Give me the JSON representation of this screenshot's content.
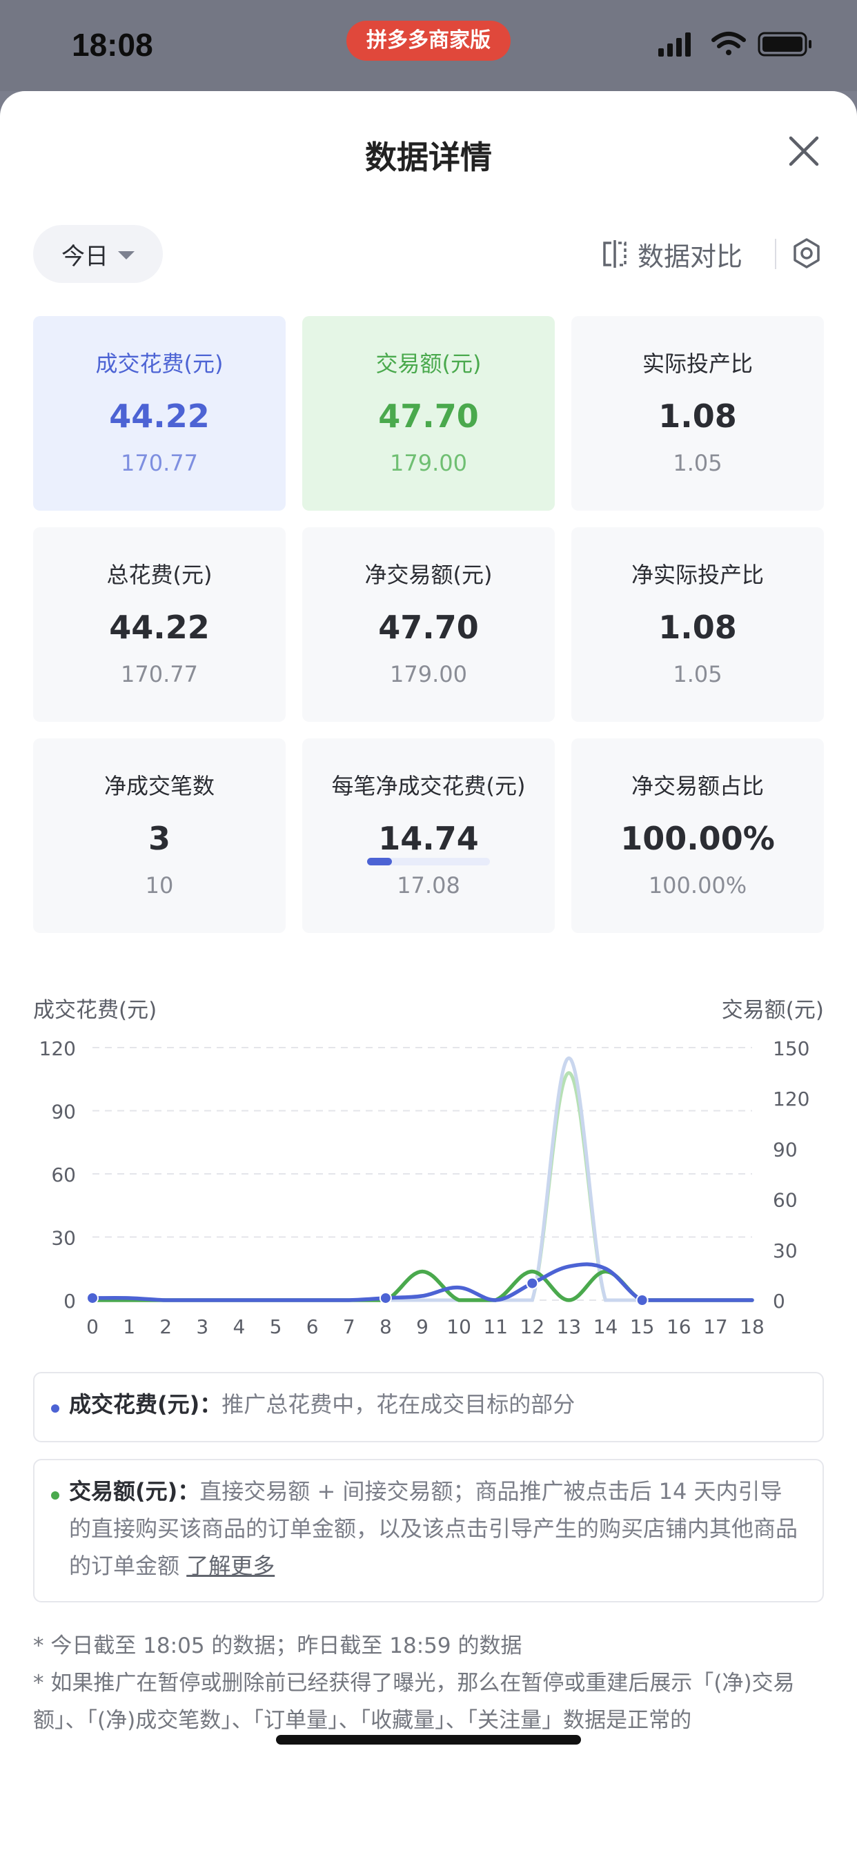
{
  "status_bar": {
    "time": "18:08",
    "app_badge": "拼多多商家版"
  },
  "header": {
    "title": "数据详情"
  },
  "filters": {
    "date_range": "今日",
    "compare_label": "数据对比"
  },
  "metrics": [
    {
      "label": "成交花费(元)",
      "value": "44.22",
      "previous": "170.77",
      "highlight": "blue"
    },
    {
      "label": "交易额(元)",
      "value": "47.70",
      "previous": "179.00",
      "highlight": "green"
    },
    {
      "label": "实际投产比",
      "value": "1.08",
      "previous": "1.05",
      "highlight": ""
    },
    {
      "label": "总花费(元)",
      "value": "44.22",
      "previous": "170.77",
      "highlight": ""
    },
    {
      "label": "净交易额(元)",
      "value": "47.70",
      "previous": "179.00",
      "highlight": ""
    },
    {
      "label": "净实际投产比",
      "value": "1.08",
      "previous": "1.05",
      "highlight": ""
    },
    {
      "label": "净成交笔数",
      "value": "3",
      "previous": "10",
      "highlight": ""
    },
    {
      "label": "每笔净成交花费(元)",
      "value": "14.74",
      "previous": "17.08",
      "highlight": ""
    },
    {
      "label": "净交易额占比",
      "value": "100.00%",
      "previous": "100.00%",
      "highlight": ""
    }
  ],
  "colors": {
    "blue": "#4c63d4",
    "green": "#4aa94d",
    "blue_light": "#c9d6ee",
    "green_light": "#b6e0b4"
  },
  "chart_data": {
    "type": "line",
    "ylabel_left": "成交花费(元)",
    "ylabel_right": "交易额(元)",
    "x": [
      0,
      1,
      2,
      3,
      4,
      5,
      6,
      7,
      8,
      9,
      10,
      11,
      12,
      13,
      14,
      15,
      16,
      17,
      18
    ],
    "left_ticks": [
      "0",
      "30",
      "60",
      "90",
      "120"
    ],
    "right_ticks": [
      "0",
      "30",
      "60",
      "90",
      "120",
      "150"
    ],
    "ylim_left": [
      0,
      120
    ],
    "ylim_right": [
      0,
      150
    ],
    "grid": true,
    "series": [
      {
        "name": "成交花费(元)",
        "axis": "left",
        "period": "today",
        "values": [
          1,
          1,
          0,
          0,
          0,
          0,
          0,
          0,
          1,
          2,
          6,
          0,
          8,
          16,
          15,
          0,
          0,
          0,
          0
        ]
      },
      {
        "name": "交易额(元)",
        "axis": "right",
        "period": "today",
        "values": [
          0,
          0,
          0,
          0,
          0,
          0,
          0,
          0,
          0,
          17,
          0,
          0,
          17,
          0,
          17,
          0,
          0,
          0,
          0
        ]
      },
      {
        "axis": "left",
        "period": "yesterday",
        "values": [
          0,
          0,
          0,
          0,
          0,
          0,
          0,
          0,
          0,
          0,
          0,
          0,
          0,
          115,
          0,
          0,
          0,
          0,
          0
        ]
      },
      {
        "axis": "right",
        "period": "yesterday",
        "values": [
          0,
          0,
          0,
          0,
          0,
          0,
          0,
          0,
          0,
          0,
          0,
          0,
          0,
          135,
          0,
          0,
          0,
          0,
          0
        ]
      }
    ]
  },
  "legend": {
    "spend": {
      "term": "成交花费(元)",
      "desc": "推广总花费中，花在成交目标的部分"
    },
    "gmv": {
      "term": "交易额(元)",
      "desc": "直接交易额 + 间接交易额；商品推广被点击后 14 天内引导的直接购买该商品的订单金额，以及该点击引导产生的购买店铺内其他商品的订单金额",
      "link": "了解更多"
    }
  },
  "footnotes": [
    "* 今日截至 18:05 的数据；昨日截至 18:59 的数据",
    "* 如果推广在暂停或删除前已经获得了曝光，那么在暂停或重建后展示「(净)交易额」、「(净)成交笔数」、「订单量」、「收藏量」、「关注量」数据是正常的"
  ]
}
